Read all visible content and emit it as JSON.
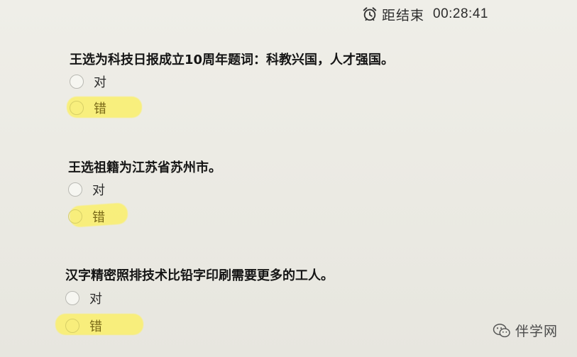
{
  "timer": {
    "label": "距结束",
    "time": "00:28:41",
    "icon": "alarm-clock-icon"
  },
  "questions": [
    {
      "text": "王选为科技日报成立10周年题词：科教兴国，人才强国。",
      "options": [
        {
          "label": "对",
          "selected": false
        },
        {
          "label": "错",
          "selected": true
        }
      ]
    },
    {
      "text": "王选祖籍为江苏省苏州市。",
      "options": [
        {
          "label": "对",
          "selected": false
        },
        {
          "label": "错",
          "selected": true
        }
      ]
    },
    {
      "text": "汉字精密照排技术比铅字印刷需要更多的工人。",
      "options": [
        {
          "label": "对",
          "selected": false
        },
        {
          "label": "错",
          "selected": true
        }
      ]
    }
  ],
  "colors": {
    "highlight": "#fbf06b",
    "background": "#ecebe4"
  },
  "watermark": {
    "text": "伴学网",
    "icon": "wechat-icon"
  }
}
